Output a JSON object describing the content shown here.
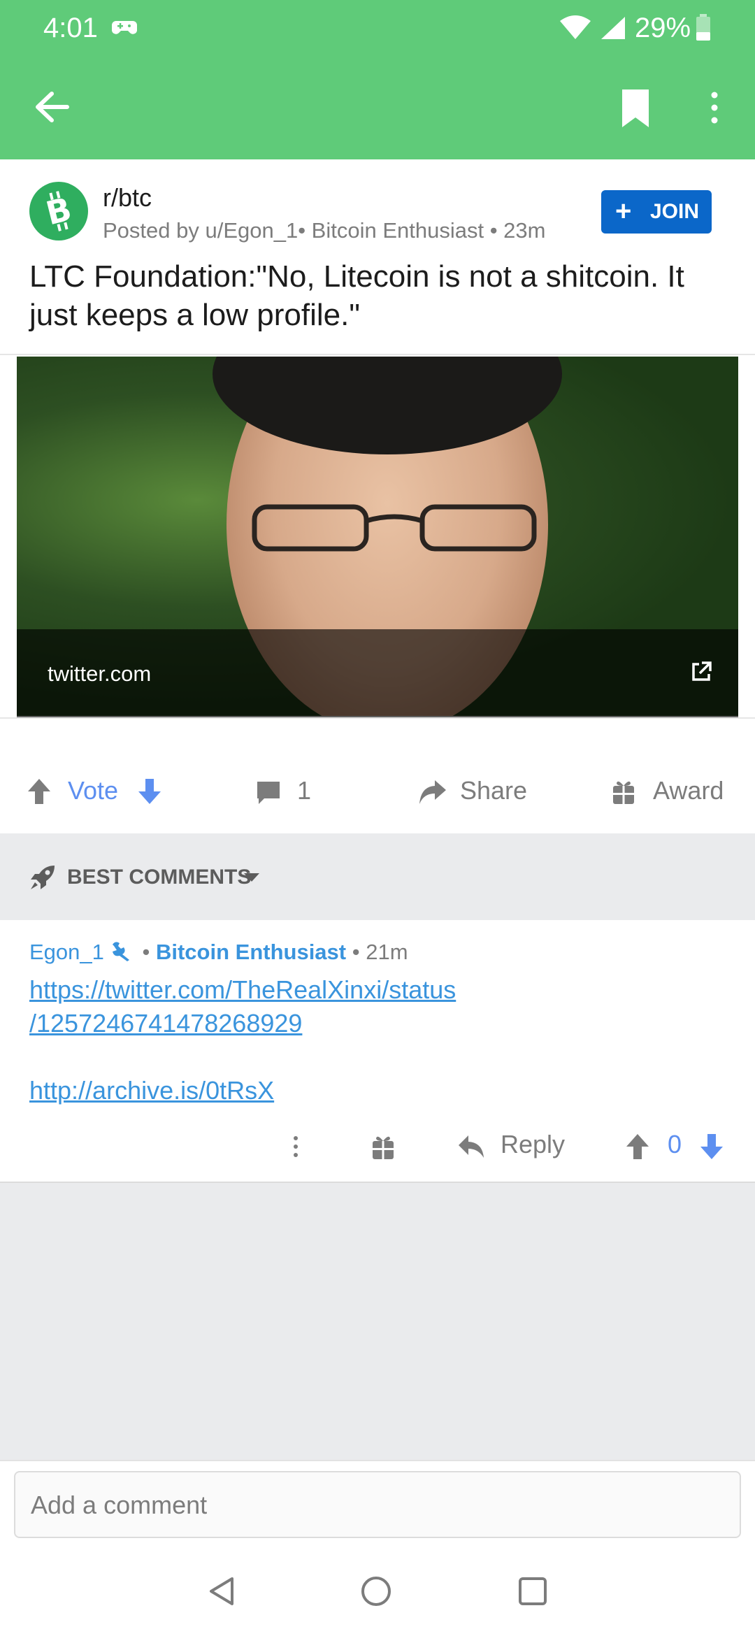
{
  "status_bar": {
    "time": "4:01",
    "battery": "29%"
  },
  "app_bar": {
    "icons": [
      "back-arrow-icon",
      "bookmark-icon",
      "more-vertical-icon"
    ],
    "color": "#5fcb79"
  },
  "post": {
    "subreddit": "r/btc",
    "posted_by": "Posted by u/Egon_1• Bitcoin Enthusiast • 23m",
    "join_label": "JOIN",
    "title": "LTC Foundation:\"No, Litecoin is not a shitcoin. It just keeps a low profile.\"",
    "link_domain": "twitter.com"
  },
  "actions": {
    "vote_label": "Vote",
    "comment_count": "1",
    "share_label": "Share",
    "award_label": "Award"
  },
  "sort": {
    "label": "BEST COMMENTS"
  },
  "comment": {
    "author": "Egon_1",
    "flair": "Bitcoin Enthusiast",
    "age": "21m",
    "link_line1": "https://twitter.com/TheRealXinxi/status",
    "link_line2": "/1257246741478268929",
    "link_archive": "http://archive.is/0tRsX",
    "reply_label": "Reply",
    "score": "0"
  },
  "composer": {
    "placeholder": "Add a comment"
  },
  "colors": {
    "accent_green": "#5fcb79",
    "join_blue": "#0b67c9",
    "link_blue": "#3a94dd",
    "vote_blue": "#5d8ff0"
  }
}
